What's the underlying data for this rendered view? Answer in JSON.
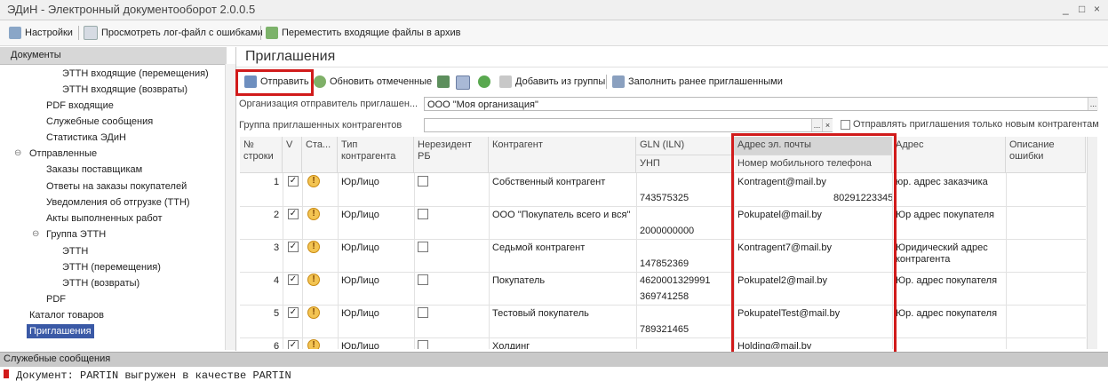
{
  "window": {
    "title": "ЭДиН - Электронный документооборот 2.0.0.5",
    "buttons": [
      "_",
      "□",
      "×"
    ]
  },
  "toolbar": {
    "settings": "Настройки",
    "view_log": "Просмотреть лог-файл с ошибками",
    "move_archive": "Переместить входящие файлы в архив"
  },
  "sidebar": {
    "header": "Документы",
    "items": [
      {
        "label": "ЭТТН входящие (перемещения)"
      },
      {
        "label": "ЭТТН входящие (возвраты)"
      },
      {
        "label": "PDF входящие"
      },
      {
        "label": "Служебные сообщения"
      },
      {
        "label": "Статистика ЭДиН"
      },
      {
        "label": "Отправленные"
      },
      {
        "label": "Заказы поставщикам"
      },
      {
        "label": "Ответы на заказы покупателей"
      },
      {
        "label": "Уведомления об отгрузке (ТТН)"
      },
      {
        "label": "Акты выполненных работ"
      },
      {
        "label": "Группа ЭТТН"
      },
      {
        "label": "ЭТТН"
      },
      {
        "label": "ЭТТН (перемещения)"
      },
      {
        "label": "ЭТТН (возвраты)"
      },
      {
        "label": "PDF"
      },
      {
        "label": "Каталог товаров"
      },
      {
        "label": "Приглашения"
      }
    ]
  },
  "main": {
    "title": "Приглашения",
    "actions": {
      "send": "Отправить",
      "refresh": "Обновить отмеченные",
      "add_group": "Добавить из группы",
      "fill_prev": "Заполнить ранее приглашенными"
    },
    "org_label": "Организация отправитель приглашен...",
    "org_value": "ООО \"Моя организация\"",
    "group_label": "Группа приглашенных контрагентов",
    "group_value": "",
    "only_new_label": "Отправлять приглашения только новым контрагентам",
    "columns": {
      "num": "№\nстроки",
      "v": "V",
      "status": "Ста...",
      "type": "Тип\nконтрагента",
      "nonres": "Нерезидент\nРБ",
      "contragent": "Контрагент",
      "gln": "GLN (ILN)",
      "unp": "УНП",
      "email": "Адрес эл. почты",
      "phone": "Номер мобильного телефона",
      "address": "Адрес",
      "error": "Описание\nошибки"
    },
    "rows": [
      {
        "n": "1",
        "type": "ЮрЛицо",
        "name": "Собственный контрагент",
        "gln": "",
        "unp": "743575325",
        "email": "Kontragent@mail.by",
        "phone": "80291223345",
        "addr": "юр. адрес заказчика"
      },
      {
        "n": "2",
        "type": "ЮрЛицо",
        "name": "ООО \"Покупатель всего и вся\"",
        "gln": "",
        "unp": "2000000000",
        "email": "Pokupatel@mail.by",
        "phone": "",
        "addr": "Юр адрес покупателя"
      },
      {
        "n": "3",
        "type": "ЮрЛицо",
        "name": "Седьмой контрагент",
        "gln": "",
        "unp": "147852369",
        "email": "Kontragent7@mail.by",
        "phone": "",
        "addr": "Юридический адрес\nконтрагента"
      },
      {
        "n": "4",
        "type": "ЮрЛицо",
        "name": "Покупатель",
        "gln": "4620001329991",
        "unp": "369741258",
        "email": "Pokupatel2@mail.by",
        "phone": "",
        "addr": "Юр. адрес покупателя"
      },
      {
        "n": "5",
        "type": "ЮрЛицо",
        "name": "Тестовый покупатель",
        "gln": "",
        "unp": "789321465",
        "email": "PokupatelTest@mail.by",
        "phone": "",
        "addr": "Юр. адрес покупателя"
      },
      {
        "n": "6",
        "type": "ЮрЛицо",
        "name": "Холдинг",
        "gln": "",
        "unp": "",
        "email": "Holding@mail.by",
        "phone": "",
        "addr": ""
      }
    ]
  },
  "service": {
    "header": "Служебные сообщения",
    "message": "Документ: PARTIN выгружен в качестве PARTIN"
  },
  "colors": {
    "accent": "#3a59a6",
    "highlight": "#d11b1b",
    "warning": "#f3c452"
  }
}
